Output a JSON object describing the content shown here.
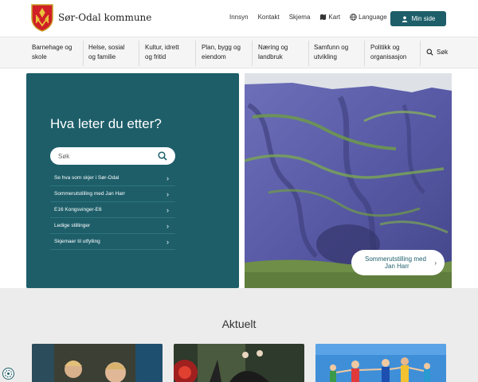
{
  "header": {
    "brand": "Sør-Odal kommune",
    "links": [
      "Innsyn",
      "Kontakt",
      "Skjema",
      "Kart",
      "Language"
    ],
    "min_side": "Min side"
  },
  "nav": {
    "categories": [
      [
        "Barnehage og",
        "skole"
      ],
      [
        "Helse, sosial",
        "og familie"
      ],
      [
        "Kultur, idrett",
        "og fritid"
      ],
      [
        "Plan, bygg og",
        "eiendom"
      ],
      [
        "Næring og",
        "landbruk"
      ],
      [
        "Samfunn og",
        "utvikling"
      ],
      [
        "Politikk og",
        "organisasjon"
      ]
    ],
    "search_label": "Søk"
  },
  "hero": {
    "title": "Hva leter du etter?",
    "search_placeholder": "Søk",
    "quick_links": [
      "Se hva som skjer i Sør-Odal",
      "Sommerutstilling med Jan Harr",
      "E16 Kongsvinger-E6",
      "Ledige stillinger",
      "Skjemaer til utfylling"
    ],
    "caption": [
      "Sommerutstilling med",
      "Jan Harr"
    ]
  },
  "aktuelt": {
    "title": "Aktuelt"
  },
  "colors": {
    "primary": "#1d5e69",
    "nav_bg": "#f5f5f5",
    "section_bg": "#ececec"
  },
  "icons": {
    "map": "map-icon",
    "globe": "globe-icon",
    "user": "user-icon",
    "search": "search-icon",
    "chevron": "chevron-right-icon"
  }
}
